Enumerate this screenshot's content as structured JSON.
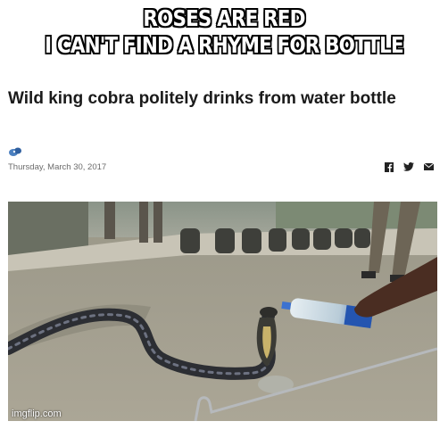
{
  "meme": {
    "top_text": "ROSES ARE RED",
    "bottom_text": "I CAN'T FIND A RHYME FOR BOTTLE"
  },
  "article": {
    "headline": "Wild king cobra politely drinks from water bottle",
    "date": "Thursday, March 30, 2017",
    "source_icon": "news-logo-icon",
    "share_icons": [
      "facebook-icon",
      "twitter-icon",
      "email-icon"
    ]
  },
  "watermark": "imgflip.com",
  "colors": {
    "caption": "#ffffff",
    "headline": "#1a1a1a",
    "date": "#6b6b6b"
  }
}
